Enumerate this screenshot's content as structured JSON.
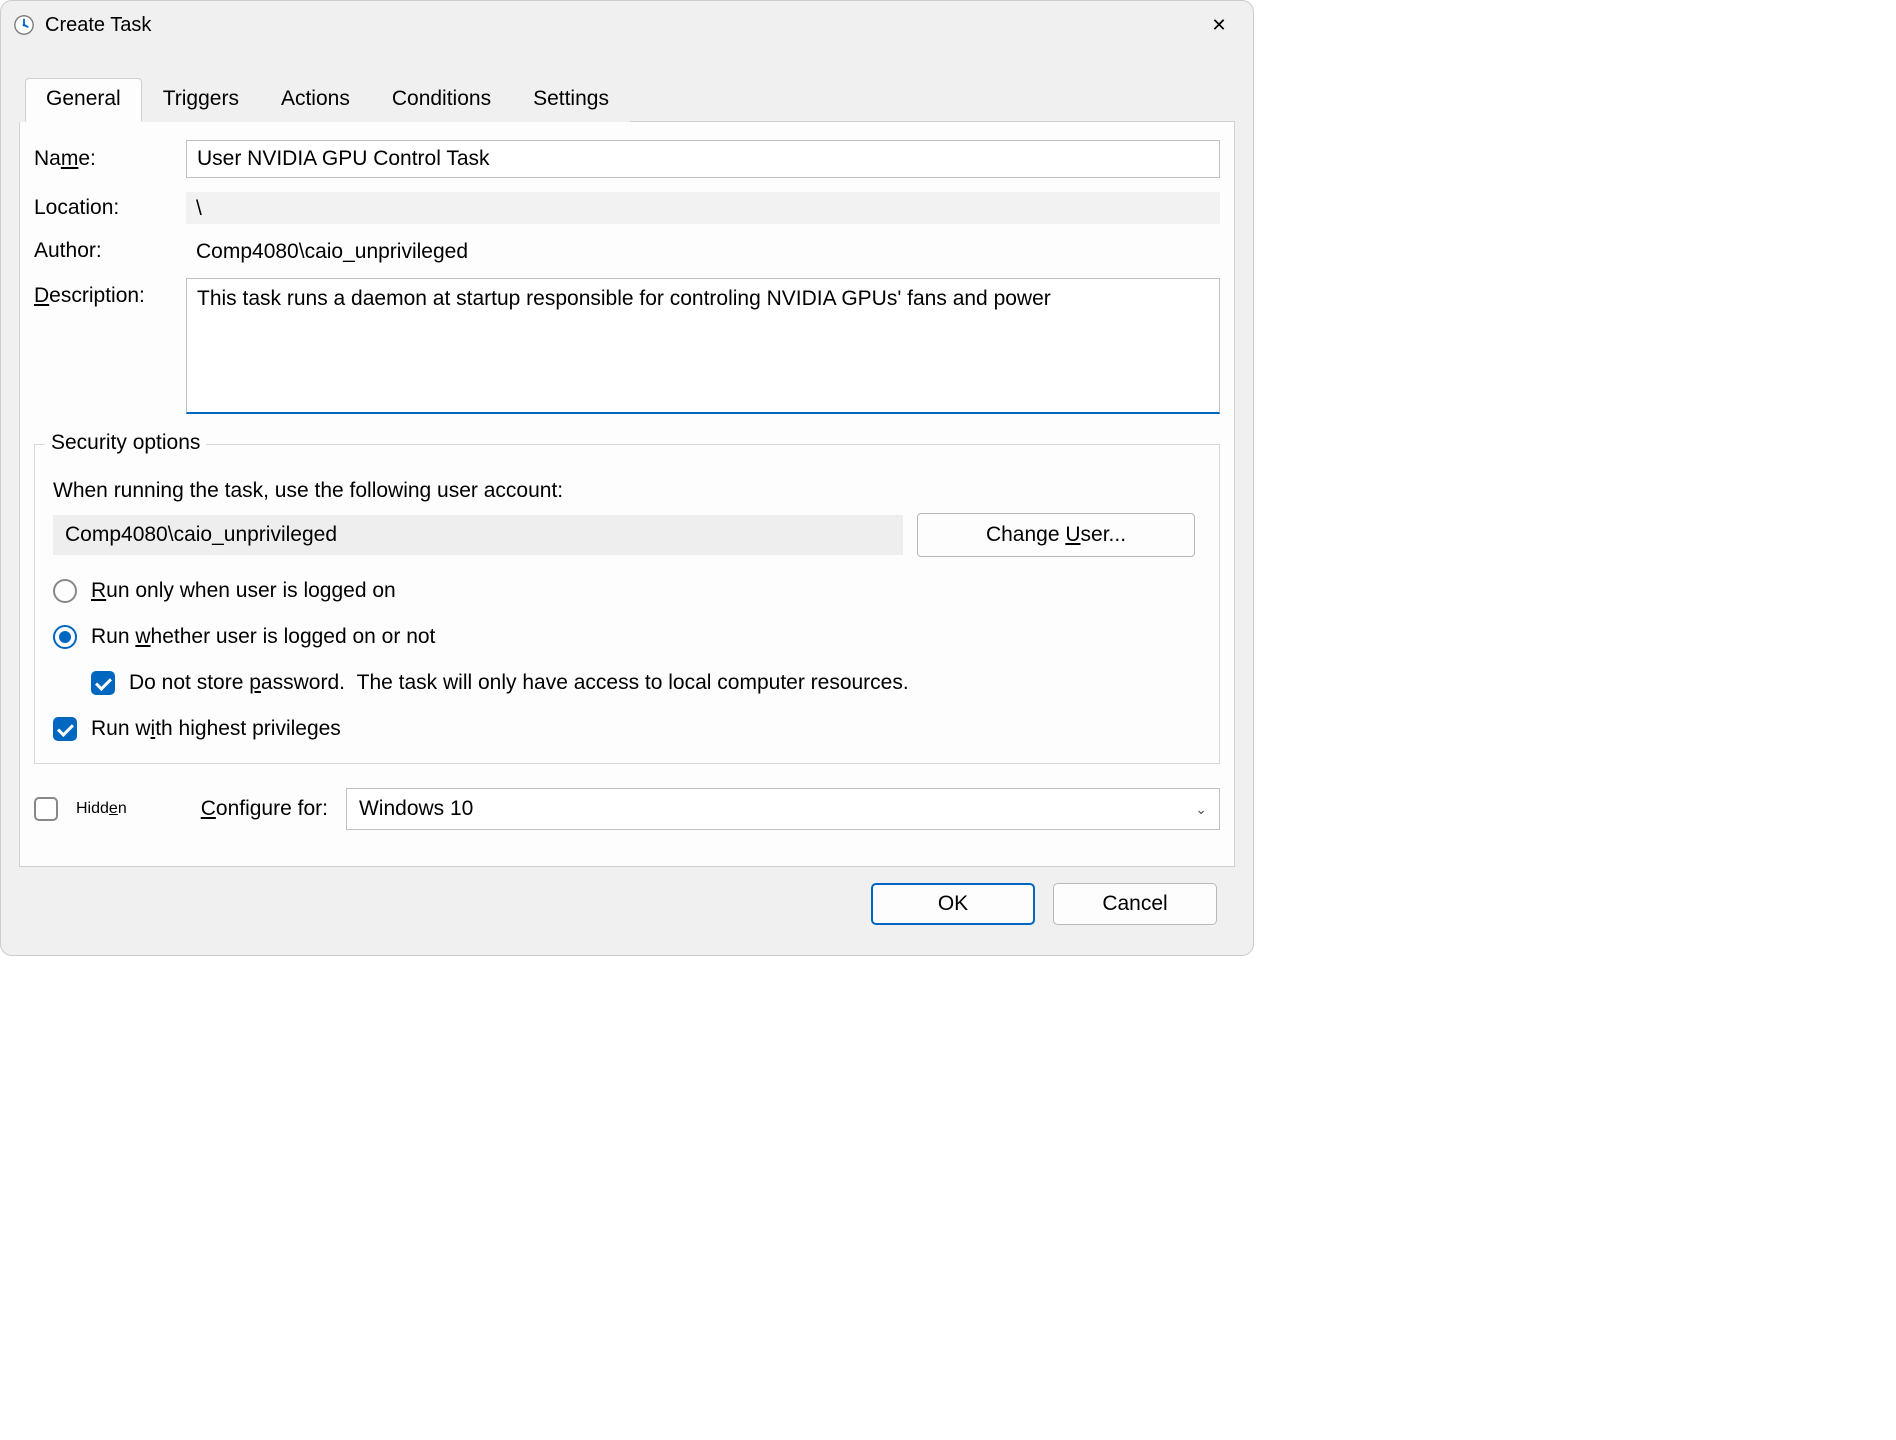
{
  "window": {
    "title": "Create Task"
  },
  "tabs": {
    "general": "General",
    "triggers": "Triggers",
    "actions": "Actions",
    "conditions": "Conditions",
    "settings": "Settings"
  },
  "form": {
    "name_label": "Name:",
    "name_value": "User NVIDIA GPU Control Task",
    "location_label": "Location:",
    "location_value": "\\",
    "author_label": "Author:",
    "author_value": "Comp4080\\caio_unprivileged",
    "description_label": "Description:",
    "description_value": "This task runs a daemon at startup responsible for controling NVIDIA GPUs' fans and power"
  },
  "security": {
    "legend": "Security options",
    "when_running": "When running the task, use the following user account:",
    "user_account": "Comp4080\\caio_unprivileged",
    "change_user": "Change User...",
    "run_logged_on": "Run only when user is logged on",
    "run_whether": "Run whether user is logged on or not",
    "no_password": "Do not store password.  The task will only have access to local computer resources.",
    "highest_priv": "Run with highest privileges"
  },
  "bottom": {
    "hidden": "Hidden",
    "configure_for": "Configure for:",
    "os": "Windows 10"
  },
  "footer": {
    "ok": "OK",
    "cancel": "Cancel"
  }
}
